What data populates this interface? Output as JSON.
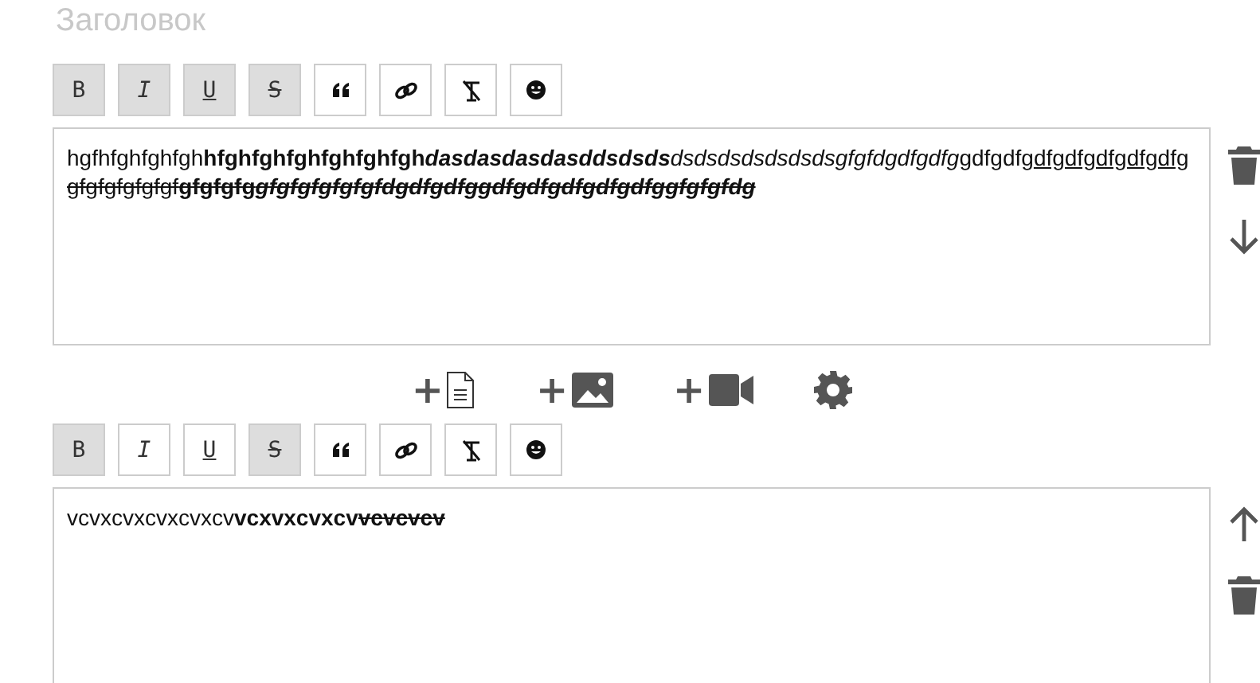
{
  "title_field": {
    "placeholder": "Заголовок"
  },
  "blocks": [
    {
      "toolbar": [
        {
          "kind": "bold",
          "label": "B",
          "active": true
        },
        {
          "kind": "italic",
          "label": "I",
          "active": true
        },
        {
          "kind": "underline",
          "label": "U",
          "active": true
        },
        {
          "kind": "strike",
          "label": "S",
          "active": true
        },
        {
          "kind": "quote",
          "active": false
        },
        {
          "kind": "link",
          "active": false
        },
        {
          "kind": "clear",
          "active": false
        },
        {
          "kind": "emoji",
          "active": false
        }
      ],
      "segments": [
        {
          "text": "hgfhfghfghfgh",
          "bold": false,
          "italic": false,
          "underline": false,
          "strike": false
        },
        {
          "text": "hfghfghfghfghfghfgh",
          "bold": true,
          "italic": false,
          "underline": false,
          "strike": false
        },
        {
          "text": "dasdasdasdasddsdsds",
          "bold": true,
          "italic": true,
          "underline": false,
          "strike": false
        },
        {
          "text": "dsdsdsdsdsdsdsgfgfdgdfgdfg",
          "bold": false,
          "italic": true,
          "underline": false,
          "strike": false
        },
        {
          "text": "gdfgdfg",
          "bold": false,
          "italic": false,
          "underline": false,
          "strike": false
        },
        {
          "text": "dfgdfgdfgdfgdfg",
          "bold": false,
          "italic": false,
          "underline": true,
          "strike": false
        },
        {
          "text": "gfgfgfgfgfgf",
          "bold": false,
          "italic": false,
          "underline": false,
          "strike": true
        },
        {
          "text": "gfgfgfg",
          "bold": true,
          "italic": false,
          "underline": false,
          "strike": true
        },
        {
          "text": "gfgfgfgfgfgfdgdfgdfggdfgdfgdfgdfgdfggfgfgfdg",
          "bold": true,
          "italic": true,
          "underline": false,
          "strike": true
        }
      ],
      "actions": [
        {
          "kind": "delete"
        },
        {
          "kind": "down"
        }
      ]
    },
    {
      "toolbar": [
        {
          "kind": "bold",
          "label": "B",
          "active": true
        },
        {
          "kind": "italic",
          "label": "I",
          "active": false
        },
        {
          "kind": "underline",
          "label": "U",
          "active": false
        },
        {
          "kind": "strike",
          "label": "S",
          "active": true
        },
        {
          "kind": "quote",
          "active": false
        },
        {
          "kind": "link",
          "active": false
        },
        {
          "kind": "clear",
          "active": false
        },
        {
          "kind": "emoji",
          "active": false
        }
      ],
      "segments": [
        {
          "text": "vcvxcvxcvxcvxcv",
          "bold": false,
          "italic": false,
          "underline": false,
          "strike": false
        },
        {
          "text": "vcxvxcvxcv",
          "bold": true,
          "italic": false,
          "underline": false,
          "strike": false
        },
        {
          "text": "vcvcvcv",
          "bold": true,
          "italic": false,
          "underline": false,
          "strike": true
        }
      ],
      "actions": [
        {
          "kind": "up"
        },
        {
          "kind": "delete"
        }
      ]
    }
  ],
  "add_buttons": [
    {
      "kind": "text",
      "label": "+"
    },
    {
      "kind": "image",
      "label": "+"
    },
    {
      "kind": "video",
      "label": "+"
    },
    {
      "kind": "settings"
    }
  ]
}
